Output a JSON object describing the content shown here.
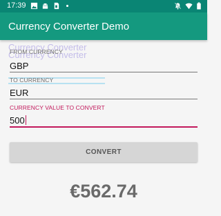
{
  "status_bar": {
    "time": "17:39",
    "left_icons": [
      "image-icon",
      "android-icon",
      "sim-card-icon",
      "dot-icon"
    ],
    "right_icons": [
      "notifications-off-icon",
      "wifi-icon",
      "battery-icon"
    ]
  },
  "app_bar": {
    "title": "Currency Converter Demo",
    "color": "#14997f"
  },
  "ghost_text": "Currency Converter\nCurrency Converter",
  "form": {
    "from": {
      "label": "FROM CURRENCY",
      "value": "GBP"
    },
    "to": {
      "label": "TO CURRENCY",
      "value": "EUR"
    },
    "amount": {
      "label": "CURRENCY VALUE TO CONVERT",
      "value": "500",
      "accent": "#c2185b"
    }
  },
  "convert_button": {
    "label": "CONVERT"
  },
  "result": {
    "value": "€562.74"
  }
}
